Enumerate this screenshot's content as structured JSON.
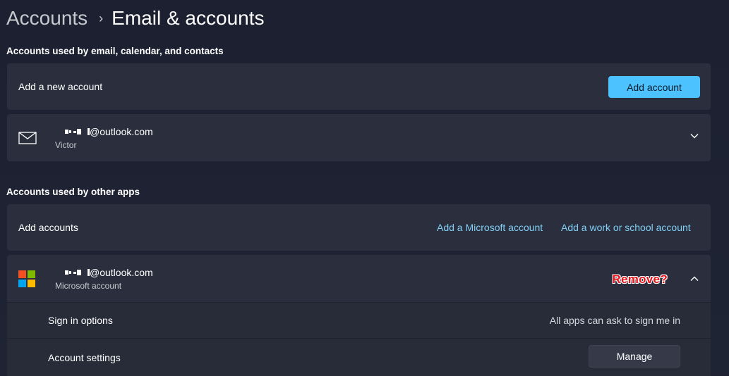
{
  "breadcrumb": {
    "parent": "Accounts",
    "separator": "›",
    "current": "Email & accounts"
  },
  "email_section": {
    "heading": "Accounts used by email, calendar, and contacts",
    "add_row": {
      "label": "Add a new account",
      "button": "Add account"
    },
    "account": {
      "icon": "mail-icon",
      "email_suffix": "@outlook.com",
      "name": "Victor",
      "expand_icon": "chevron-down-icon"
    }
  },
  "other_apps_section": {
    "heading": "Accounts used by other apps",
    "add_row": {
      "label": "Add accounts",
      "link_ms": "Add a Microsoft account",
      "link_work": "Add a work or school account"
    },
    "account": {
      "icon": "microsoft-logo-icon",
      "email_suffix": "@outlook.com",
      "type": "Microsoft account",
      "annotation": "Remove?",
      "collapse_icon": "chevron-up-icon",
      "sign_in": {
        "label": "Sign in options",
        "value": "All apps can ask to sign me in"
      },
      "settings": {
        "label": "Account settings",
        "button": "Manage"
      }
    }
  },
  "colors": {
    "accent": "#4cc2ff",
    "link": "#7fcff6",
    "card": "#2b2f3d",
    "annotation": "#e8141b",
    "ms_red": "#f25022",
    "ms_green": "#7fba00",
    "ms_blue": "#00a4ef",
    "ms_yellow": "#ffb900"
  }
}
